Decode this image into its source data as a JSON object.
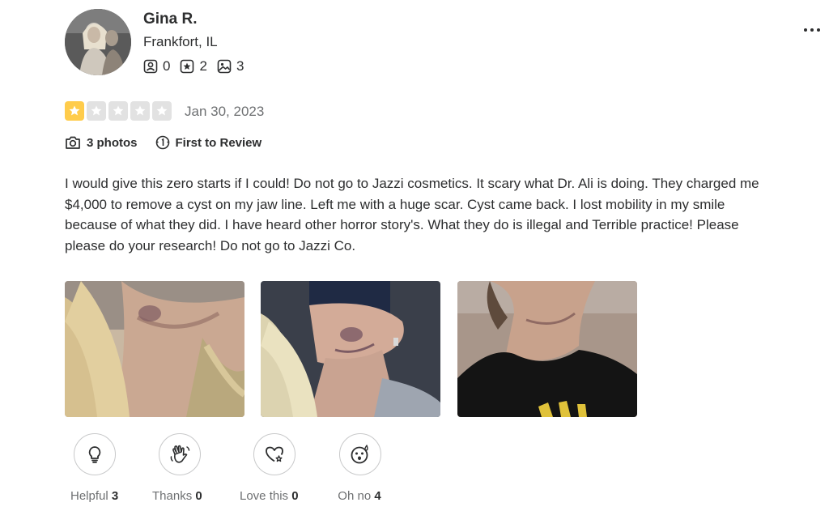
{
  "user": {
    "name": "Gina R.",
    "location": "Frankfort, IL",
    "stats": {
      "friends": "0",
      "reviews": "2",
      "photos": "3"
    }
  },
  "review": {
    "rating": 1,
    "max_rating": 5,
    "date": "Jan 30, 2023",
    "photos_badge": "3 photos",
    "first_badge": "First to Review",
    "text": "I would give this zero starts if I could! Do not go to Jazzi cosmetics. It scary what Dr. Ali is doing. They charged me $4,000 to remove a cyst on my jaw line. Left me with a huge scar. Cyst came back. I lost mobility in my smile because of what they did. I have heard other horror story's. What they do is illegal and Terrible practice! Please please do your research! Do not go to Jazzi Co."
  },
  "reactions": [
    {
      "label": "Helpful",
      "count": "3",
      "icon": "lightbulb-icon"
    },
    {
      "label": "Thanks",
      "count": "0",
      "icon": "waving-hand-icon"
    },
    {
      "label": "Love this",
      "count": "0",
      "icon": "heart-icon"
    },
    {
      "label": "Oh no",
      "count": "4",
      "icon": "surprised-face-icon"
    }
  ],
  "colors": {
    "star_on": "#ffcc4b",
    "star_off": "#e2e2e2",
    "text": "#2d2e2f",
    "muted": "#6e7072"
  }
}
